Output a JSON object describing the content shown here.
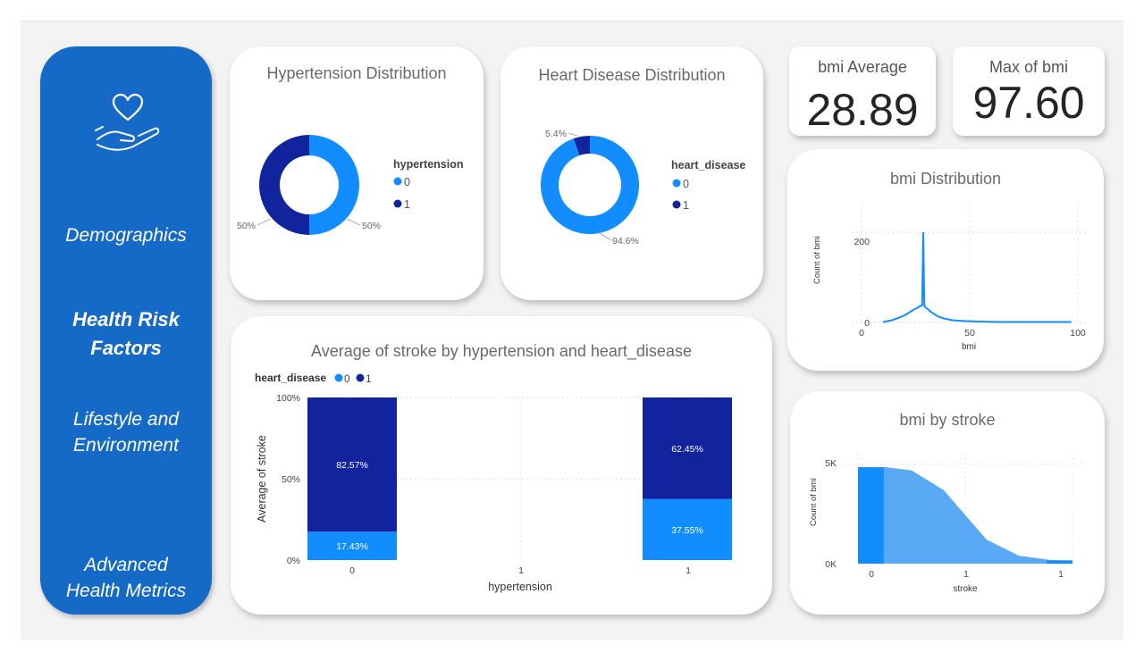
{
  "nav": {
    "items": [
      "Demographics",
      "Health Risk Factors",
      "Lifestyle and Environment",
      "Advanced Health Metrics"
    ],
    "active": "Health Risk Factors",
    "logo_icon": "heart-in-hand-icon"
  },
  "colors": {
    "sidebar": "#1569c7",
    "series0": "#118dff",
    "series1": "#12239e",
    "area": "#5aa9f5"
  },
  "hypertension_card": {
    "title": "Hypertension Distribution",
    "legend_title": "hypertension",
    "legend": [
      "0",
      "1"
    ],
    "label_left": "50%",
    "label_right": "50%"
  },
  "heart_card": {
    "title": "Heart Disease Distribution",
    "legend_title": "heart_disease",
    "legend": [
      "0",
      "1"
    ],
    "label_small": "5.4%",
    "label_large": "94.6%"
  },
  "kpi_avg": {
    "label": "bmi Average",
    "value": "28.89"
  },
  "kpi_max": {
    "label": "Max of bmi",
    "value": "97.60"
  },
  "bmi_dist": {
    "title": "bmi Distribution",
    "ylabel": "Count of bmi",
    "xlabel": "bmi",
    "yticks": [
      "200",
      "0"
    ],
    "xticks": [
      "0",
      "50",
      "100"
    ]
  },
  "stroke_card": {
    "title": "Average of stroke by hypertension and heart_disease",
    "legend_title": "heart_disease",
    "legend": [
      "0",
      "1"
    ],
    "ylabel": "Average of stroke",
    "xlabel": "hypertension",
    "yticks": [
      "100%",
      "50%",
      "0%"
    ],
    "xticks": [
      "0",
      "1",
      "1"
    ]
  },
  "bmi_stroke": {
    "title": "bmi by stroke",
    "ylabel": "Count of bmi",
    "xlabel": "stroke",
    "yticks": [
      "5K",
      "0K"
    ],
    "xticks": [
      "0",
      "1",
      "1"
    ]
  },
  "chart_data": [
    {
      "type": "pie",
      "title": "Hypertension Distribution",
      "legend_title": "hypertension",
      "categories": [
        "0",
        "1"
      ],
      "values": [
        50,
        50
      ],
      "donut": true,
      "legend": "right"
    },
    {
      "type": "pie",
      "title": "Heart Disease Distribution",
      "legend_title": "heart_disease",
      "categories": [
        "0",
        "1"
      ],
      "values": [
        94.6,
        5.4
      ],
      "donut": true,
      "legend": "right"
    },
    {
      "type": "line",
      "title": "bmi Distribution",
      "xlabel": "bmi",
      "ylabel": "Count of bmi",
      "xlim": [
        0,
        100
      ],
      "ylim": [
        0,
        230
      ],
      "grid": true,
      "x": [
        10,
        14,
        17,
        20,
        22,
        24,
        26,
        27,
        28,
        28.5,
        29,
        30,
        32,
        35,
        38,
        42,
        48,
        55,
        65,
        75,
        85,
        97
      ],
      "y": [
        1,
        5,
        10,
        16,
        22,
        28,
        33,
        36,
        38,
        200,
        36,
        32,
        24,
        14,
        9,
        5,
        3,
        2,
        1,
        1,
        1,
        1
      ]
    },
    {
      "type": "bar",
      "stacked": true,
      "title": "Average of stroke by hypertension and heart_disease",
      "xlabel": "hypertension",
      "ylabel": "Average of stroke",
      "categories": [
        "0",
        "1"
      ],
      "ylim": [
        0,
        100
      ],
      "legend": "top-left",
      "series": [
        {
          "name": "0",
          "values": [
            17.43,
            37.55
          ],
          "labels": [
            "17.43%",
            "37.55%"
          ]
        },
        {
          "name": "1",
          "values": [
            82.57,
            62.45
          ],
          "labels": [
            "82.57%",
            "62.45%"
          ]
        }
      ]
    },
    {
      "type": "area",
      "title": "bmi by stroke",
      "xlabel": "stroke",
      "ylabel": "Count of bmi",
      "xlim": [
        0,
        1
      ],
      "ylim": [
        0,
        5400
      ],
      "grid": true,
      "x": [
        0,
        0.13,
        0.25,
        0.4,
        0.5,
        0.6,
        0.75,
        0.9,
        1.0
      ],
      "y": [
        4860,
        4860,
        4700,
        3700,
        2450,
        1200,
        400,
        180,
        160
      ]
    }
  ]
}
